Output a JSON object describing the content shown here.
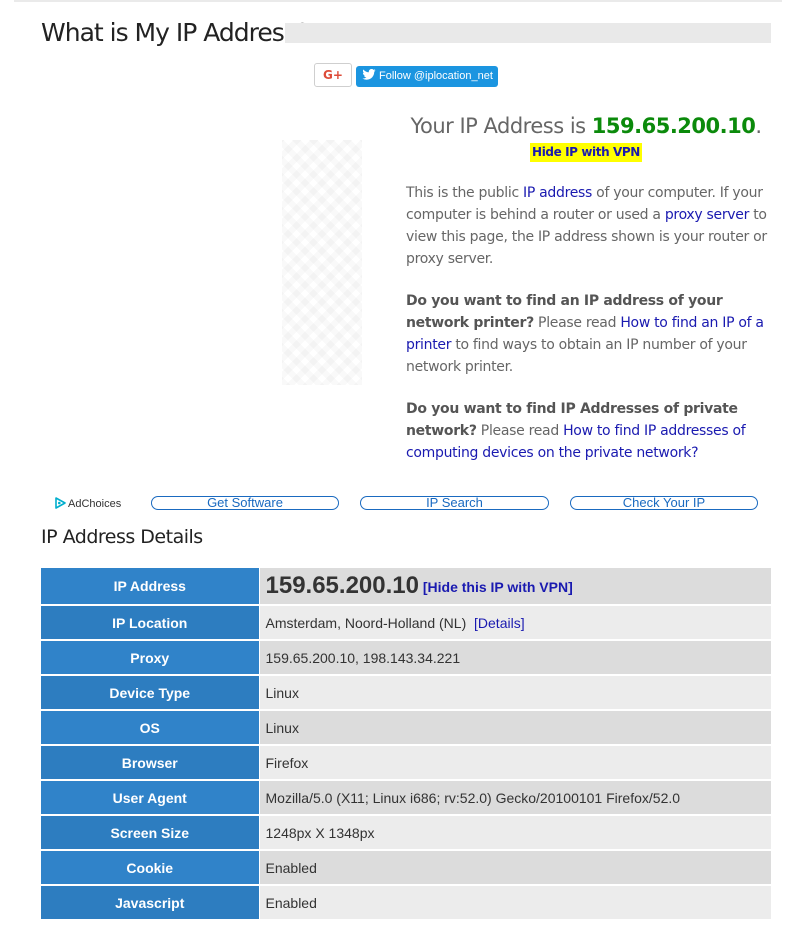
{
  "header": {
    "title": "What is My IP Address?"
  },
  "share": {
    "gplus_label": "G+",
    "twitter_label": "Follow @iplocation_net"
  },
  "ip_summary": {
    "prefix": "Your IP Address is",
    "ip": "159.65.200.10",
    "suffix": ".",
    "hide_vpn_label": "Hide IP with VPN"
  },
  "info": {
    "p1": {
      "t1": "This is the public ",
      "link1": "IP address",
      "t2": " of your computer. If your computer is behind a router or used a ",
      "link2": "proxy server",
      "t3": " to view this page, the IP address shown is your router or proxy server."
    },
    "p2": {
      "bold": "Do you want to find an IP address of your network printer?",
      "t1": " Please read ",
      "link": "How to find an IP of a printer",
      "t2": " to find ways to obtain an IP number of your network printer."
    },
    "p3": {
      "bold": "Do you want to find IP Addresses of private network?",
      "t1": " Please read ",
      "link": "How to find IP addresses of computing devices on the private network?"
    }
  },
  "nav": {
    "adchoices": "AdChoices",
    "get_software": "Get Software",
    "ip_search": "IP Search",
    "check_ip": "Check Your IP"
  },
  "details": {
    "title": "IP Address Details",
    "ip_address": {
      "label": "IP Address",
      "value": "159.65.200.10",
      "link": "[Hide this IP with VPN]"
    },
    "ip_location": {
      "label": "IP Location",
      "value": "Amsterdam, Noord-Holland (NL)",
      "link": "[Details]"
    },
    "rows": [
      {
        "label": "Proxy",
        "value": "159.65.200.10, 198.143.34.221"
      },
      {
        "label": "Device Type",
        "value": "Linux"
      },
      {
        "label": "OS",
        "value": "Linux"
      },
      {
        "label": "Browser",
        "value": "Firefox"
      },
      {
        "label": "User Agent",
        "value": "Mozilla/5.0 (X11; Linux i686; rv:52.0) Gecko/20100101 Firefox/52.0"
      },
      {
        "label": "Screen Size",
        "value": "1248px X 1348px"
      },
      {
        "label": "Cookie",
        "value": "Enabled"
      },
      {
        "label": "Javascript",
        "value": "Enabled"
      }
    ]
  },
  "colors": {
    "accent_blue": "#3083c9",
    "ip_green": "#0b8a0b",
    "link_blue": "#1a1ab0",
    "highlight_yellow": "#ffff00",
    "twitter_blue": "#1b95e0"
  },
  "icons": {
    "gplus": "google-plus-icon",
    "twitter": "twitter-bird-icon",
    "adchoices": "adchoices-icon"
  }
}
